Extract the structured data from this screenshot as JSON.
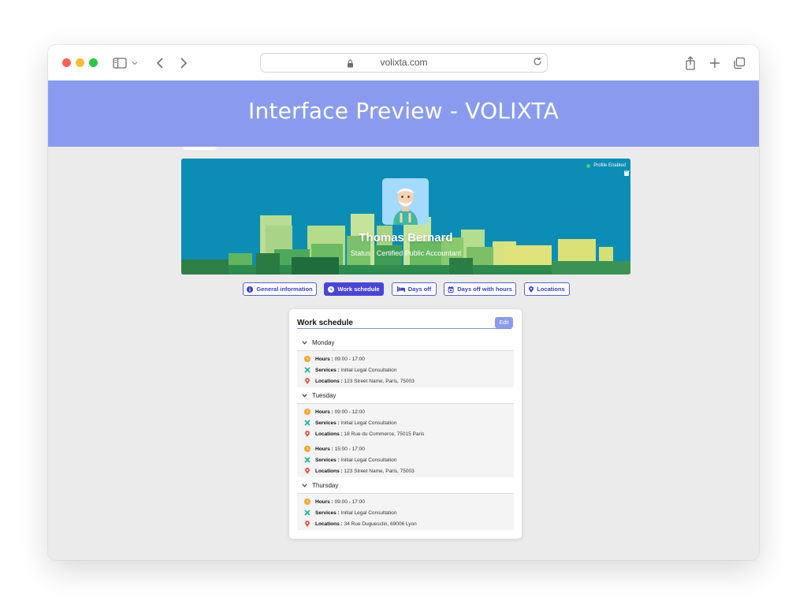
{
  "browser": {
    "url": "volixta.com"
  },
  "page": {
    "title": "Interface Preview - VOLIXTA"
  },
  "profile": {
    "status_text": "Profile Enabled",
    "name": "Thomas Bernard",
    "status_line": "Status : Certified Public Accountant"
  },
  "tabs": [
    {
      "label": "General information",
      "icon": "info-icon"
    },
    {
      "label": "Work schedule",
      "icon": "clock-icon",
      "active": true
    },
    {
      "label": "Days off",
      "icon": "bed-icon"
    },
    {
      "label": "Days off with hours",
      "icon": "calendar-icon"
    },
    {
      "label": "Locations",
      "icon": "map-pin-icon"
    }
  ],
  "schedule": {
    "title": "Work schedule",
    "edit_label": "Edit",
    "hours_label": "Hours :",
    "services_label": "Services :",
    "locations_label": "Locations :",
    "days": [
      {
        "name": "Monday",
        "slots": [
          {
            "hours": "09:00 - 17:00",
            "service": "Initial Legal Consultation",
            "location": "123 Street Name, Paris, 75003"
          }
        ]
      },
      {
        "name": "Tuesday",
        "slots": [
          {
            "hours": "09:00 - 12:00",
            "service": "Initial Legal Consultation",
            "location": "18 Rue du Commerce, 75015 Paris"
          },
          {
            "hours": "15:00 - 17:00",
            "service": "Initial Legal Consultation",
            "location": "123 Street Name, Paris, 75003"
          }
        ]
      },
      {
        "name": "Thursday",
        "slots": [
          {
            "hours": "09:00 - 17:00",
            "service": "Initial Legal Consultation",
            "location": "34 Rue Duguesclin, 69006 Lyon"
          }
        ]
      }
    ]
  },
  "colors": {
    "banner": "#8a9bef",
    "hero_bg": "#0c8db5",
    "accent": "#4a45d8",
    "status_dot": "#3fd17a",
    "clock_icon": "#f5a623",
    "pin_icon": "#e5534b",
    "service_icon": "#1abc9c"
  }
}
